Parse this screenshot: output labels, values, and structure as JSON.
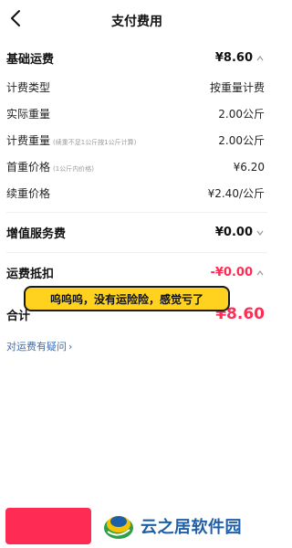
{
  "header": {
    "title": "支付费用",
    "back_icon": "chevron-left-icon"
  },
  "basic_fee": {
    "label": "基础运费",
    "amount": "¥8.60",
    "rows": [
      {
        "label": "计费类型",
        "note": "",
        "value": "按重量计费"
      },
      {
        "label": "实际重量",
        "note": "",
        "value": "2.00公斤"
      },
      {
        "label": "计费重量",
        "note": "(续重不足1公斤按1公斤计算)",
        "value": "2.00公斤"
      },
      {
        "label": "首重价格",
        "note": "(1公斤内价格)",
        "value": "¥6.20"
      },
      {
        "label": "续重价格",
        "note": "",
        "value": "¥2.40/公斤"
      }
    ]
  },
  "value_added": {
    "label": "增值服务费",
    "amount": "¥0.00"
  },
  "deduction": {
    "label": "运费抵扣",
    "amount": "-¥0.00"
  },
  "total": {
    "label": "合计",
    "amount": "¥8.60"
  },
  "help_link": "对运费有疑问",
  "bubble_text": "呜呜呜，没有运险险，感觉亏了",
  "watermark": "云之居软件园",
  "colors": {
    "accent": "#ff2d55",
    "link": "#3a6fb5",
    "bubble": "#ffd21f"
  }
}
